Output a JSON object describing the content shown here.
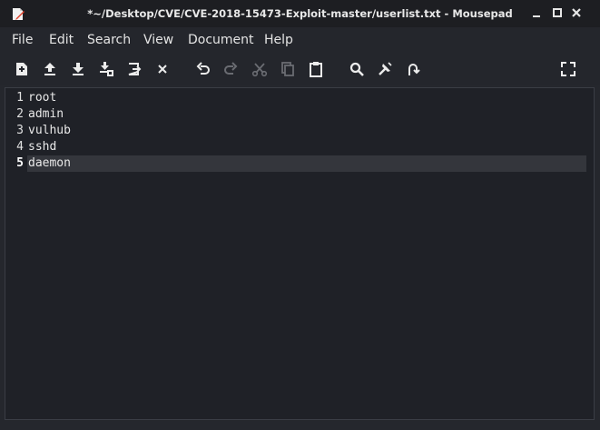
{
  "window": {
    "title": "*~/Desktop/CVE/CVE-2018-15473-Exploit-master/userlist.txt - Mousepad",
    "controls": [
      "minimize",
      "maximize",
      "close"
    ]
  },
  "menubar": {
    "items": [
      "File",
      "Edit",
      "Search",
      "View",
      "Document",
      "Help"
    ]
  },
  "toolbar": {
    "icons": [
      "new-document-icon",
      "open-icon",
      "save-icon",
      "save-as-icon",
      "reload-icon",
      "close-document-icon",
      "undo-icon",
      "redo-icon",
      "cut-icon",
      "copy-icon",
      "paste-icon",
      "find-icon",
      "find-replace-icon",
      "go-to-line-icon",
      "fullscreen-icon"
    ]
  },
  "editor": {
    "lines": [
      {
        "number": "1",
        "text": "root"
      },
      {
        "number": "2",
        "text": "admin"
      },
      {
        "number": "3",
        "text": "vulhub"
      },
      {
        "number": "4",
        "text": "sshd"
      },
      {
        "number": "5",
        "text": "daemon"
      }
    ],
    "current_line": 5
  },
  "colors": {
    "background": "#1f2127",
    "chrome": "#24262c",
    "current_line": "#34363c",
    "text": "#e8e8e8"
  }
}
